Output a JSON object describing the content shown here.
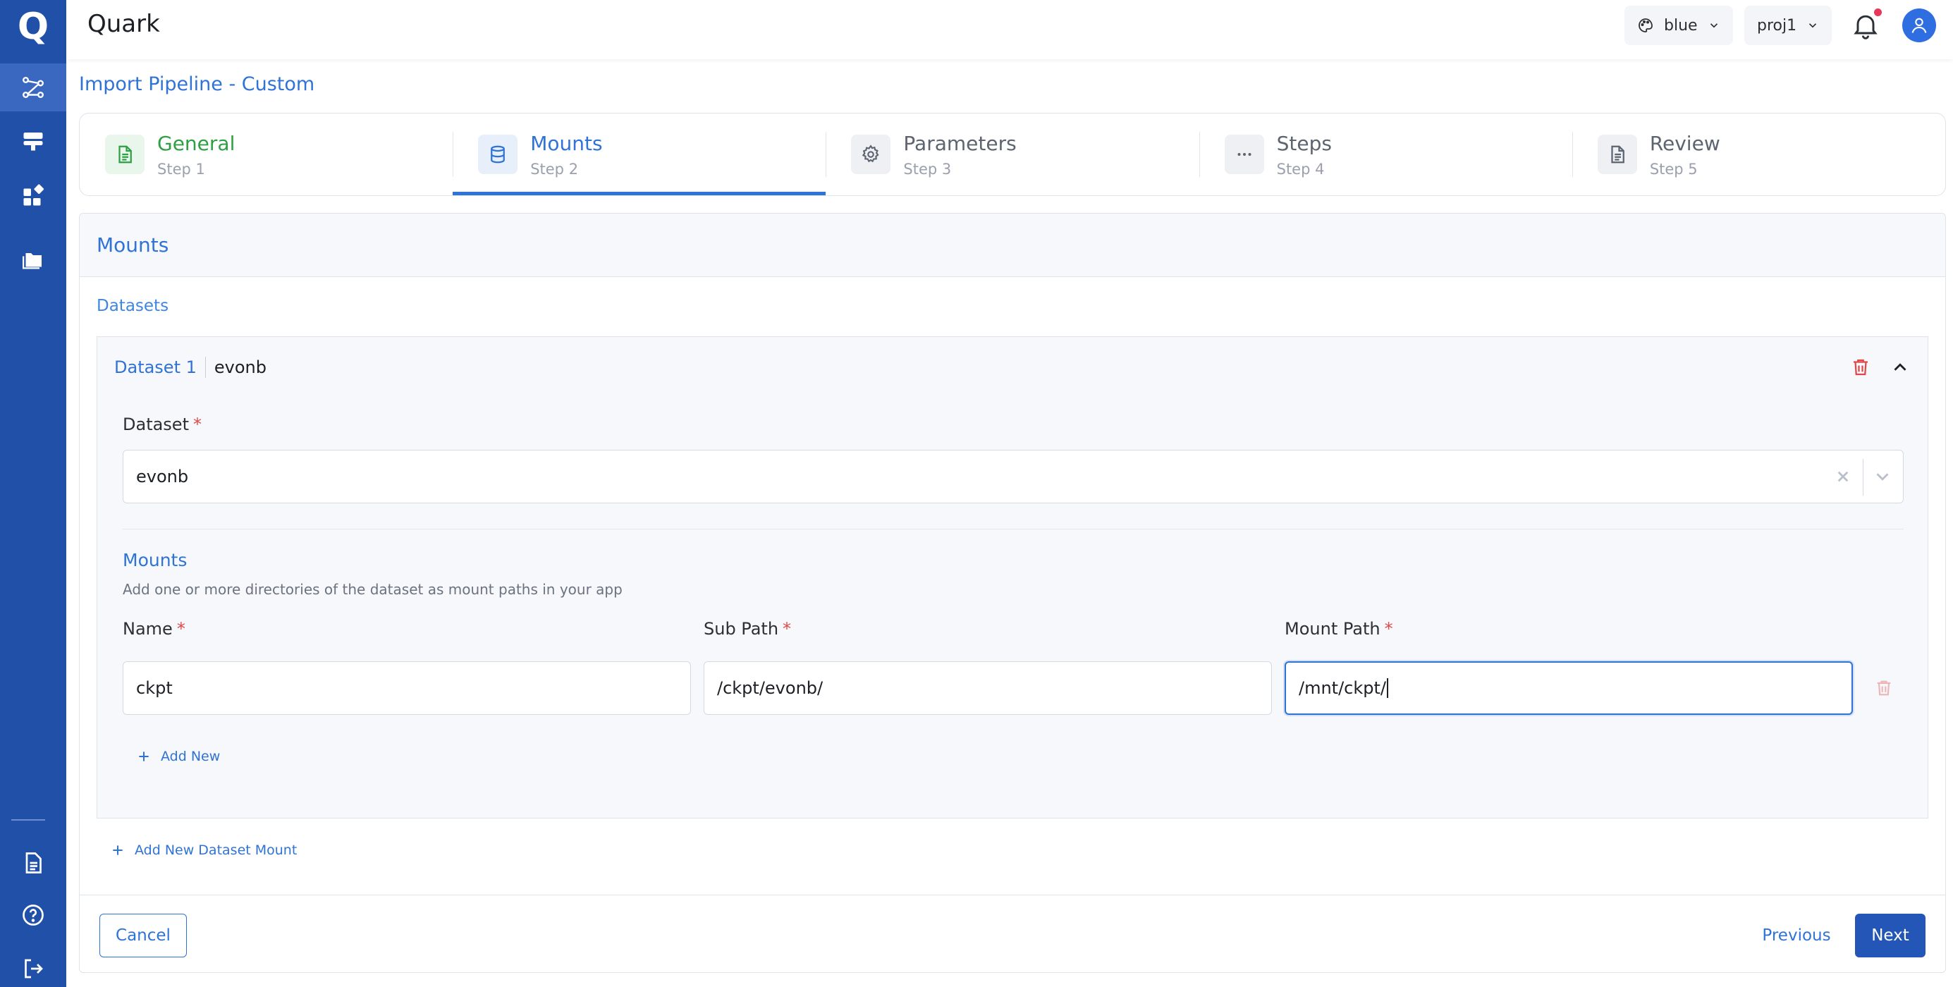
{
  "app": {
    "title": "Quark",
    "logo": "Q"
  },
  "topbar": {
    "theme": {
      "label": "blue",
      "icon": "palette-icon"
    },
    "project": {
      "label": "proj1"
    },
    "notifications": {
      "icon": "bell-icon",
      "has_unread": true
    },
    "user": {
      "icon": "user-icon"
    }
  },
  "sidebar": {
    "items": [
      {
        "icon": "pipeline-icon",
        "active": true
      },
      {
        "icon": "server-icon",
        "active": false
      },
      {
        "icon": "apps-icon",
        "active": false
      },
      {
        "icon": "folder-icon",
        "active": false
      },
      {
        "icon": "document-icon",
        "active": false
      },
      {
        "icon": "help-icon",
        "active": false
      },
      {
        "icon": "logout-icon",
        "active": false
      }
    ]
  },
  "page": {
    "title": "Import Pipeline - Custom"
  },
  "steps": [
    {
      "label": "General",
      "sub": "Step 1",
      "state": "done",
      "icon": "document-icon"
    },
    {
      "label": "Mounts",
      "sub": "Step 2",
      "state": "active",
      "icon": "database-icon"
    },
    {
      "label": "Parameters",
      "sub": "Step 3",
      "state": "pending",
      "icon": "gear-icon"
    },
    {
      "label": "Steps",
      "sub": "Step 4",
      "state": "pending",
      "icon": "ellipsis-icon"
    },
    {
      "label": "Review",
      "sub": "Step 5",
      "state": "pending",
      "icon": "document-icon"
    }
  ],
  "card": {
    "title": "Mounts",
    "datasets_label": "Datasets",
    "dataset": {
      "index_label": "Dataset 1",
      "name": "evonb",
      "field_label": "Dataset",
      "required_mark": "*",
      "selected_value": "evonb",
      "mounts_title": "Mounts",
      "mounts_description": "Add one or more directories of the dataset as mount paths in your app",
      "columns": {
        "name": "Name",
        "sub_path": "Sub Path",
        "mount_path": "Mount Path"
      },
      "mount_row": {
        "name": "ckpt",
        "sub_path": "/ckpt/evonb/",
        "mount_path": "/mnt/ckpt/"
      },
      "add_new_label": "Add New"
    },
    "add_dataset_label": "Add New Dataset Mount"
  },
  "footer": {
    "cancel": "Cancel",
    "previous": "Previous",
    "next": "Next"
  },
  "colors": {
    "primary": "#2f73d6",
    "sidebar": "#2150a8",
    "success": "#2ea043",
    "danger": "#e04848"
  }
}
